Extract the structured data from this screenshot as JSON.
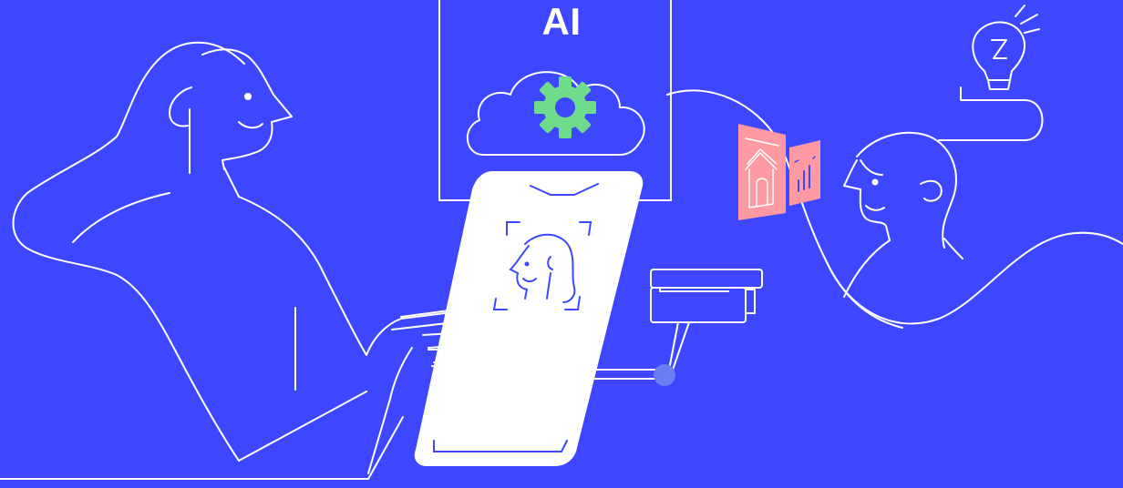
{
  "ai_label": "AI",
  "colors": {
    "background": "#3d47ff",
    "line": "#ffffff",
    "gear": "#6fdc8c",
    "card": "#ff9aa2",
    "phone_sketch": "#3d47ff",
    "joint": "#6b7df0"
  },
  "icons": [
    "gear-icon",
    "cloud-icon",
    "lightbulb-icon",
    "house-icon",
    "bar-chart-icon",
    "face-scan-icon"
  ]
}
